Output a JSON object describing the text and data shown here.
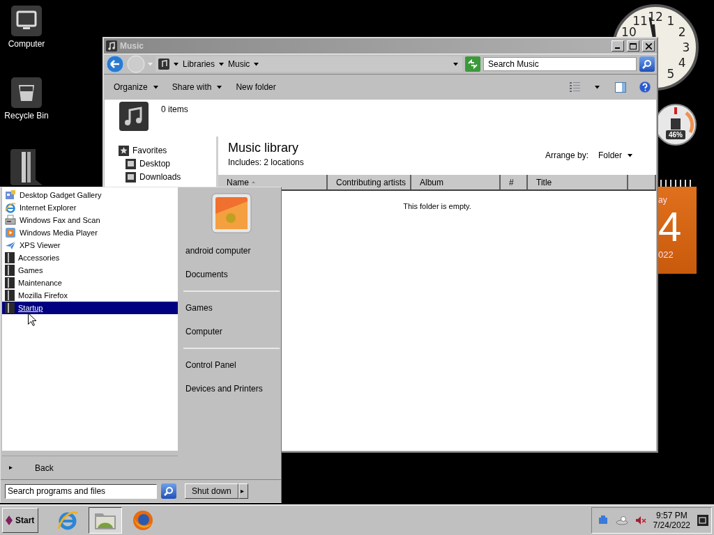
{
  "desktop_icons": [
    {
      "kind": "computer",
      "label": "Computer"
    },
    {
      "kind": "bin",
      "label": "Recycle Bin"
    },
    {
      "kind": "folder"
    }
  ],
  "gadgets": {
    "clock": {
      "numerals": [
        "10",
        "11",
        "12",
        "1",
        "2",
        "3",
        "4",
        "5"
      ]
    },
    "cpu_meter": {
      "reading": "46%"
    },
    "calendar": {
      "weekday": "ay",
      "day": "4",
      "year": "022"
    }
  },
  "window": {
    "title": "Music",
    "address": [
      "Libraries",
      "Music"
    ],
    "search": {
      "placeholder": "Search Music"
    },
    "toolbar": [
      {
        "label": "Organize",
        "dropdown": true
      },
      {
        "label": "Share with",
        "dropdown": true
      },
      {
        "label": "New folder",
        "dropdown": false
      }
    ],
    "details": {
      "count": "0 items"
    },
    "navigation": {
      "title": "Favorites",
      "items": [
        "Desktop",
        "Downloads"
      ]
    },
    "library": {
      "title": "Music library",
      "includes": "Includes:  2 locations",
      "arrange_label": "Arrange by:",
      "arrange_value": "Folder"
    },
    "columns": [
      {
        "label": "Name",
        "sorted": true
      },
      {
        "label": "Contributing artists",
        "sorted": false
      },
      {
        "label": "Album",
        "sorted": false
      },
      {
        "label": "#",
        "sorted": false
      },
      {
        "label": "Title",
        "sorted": false
      },
      {
        "sorted": false
      }
    ],
    "empty_message": "This folder is empty."
  },
  "start_menu": {
    "programs": [
      {
        "label": "Desktop Gadget Gallery",
        "kind": "gadget",
        "selected": false
      },
      {
        "label": "Internet Explorer",
        "kind": "ie",
        "selected": false
      },
      {
        "label": "Windows Fax and Scan",
        "kind": "fax",
        "selected": false
      },
      {
        "label": "Windows Media Player",
        "kind": "media",
        "selected": false
      },
      {
        "label": "XPS Viewer",
        "kind": "xps",
        "selected": false
      },
      {
        "label": "Accessories",
        "kind": "folder",
        "selected": false
      },
      {
        "label": "Games",
        "kind": "folder",
        "selected": false
      },
      {
        "label": "Maintenance",
        "kind": "folder",
        "selected": false
      },
      {
        "label": "Mozilla Firefox",
        "kind": "folder",
        "selected": false
      },
      {
        "label": "Startup",
        "kind": "folder",
        "selected": true
      }
    ],
    "back": "Back",
    "places": [
      [
        "android computer",
        "Documents"
      ],
      [
        "Games",
        "Computer"
      ],
      [
        "Control Panel",
        "Devices and Printers"
      ]
    ],
    "search": {
      "placeholder": "Search programs and files"
    },
    "shutdown": "Shut down"
  },
  "taskbar": {
    "start": "Start",
    "apps": [
      {
        "kind": "ie",
        "selected": false
      },
      {
        "kind": "explorer",
        "selected": true
      },
      {
        "kind": "firefox",
        "selected": false
      }
    ],
    "tray": {
      "volume_muted": true,
      "time": "9:57 PM",
      "date": "7/24/2022"
    }
  }
}
